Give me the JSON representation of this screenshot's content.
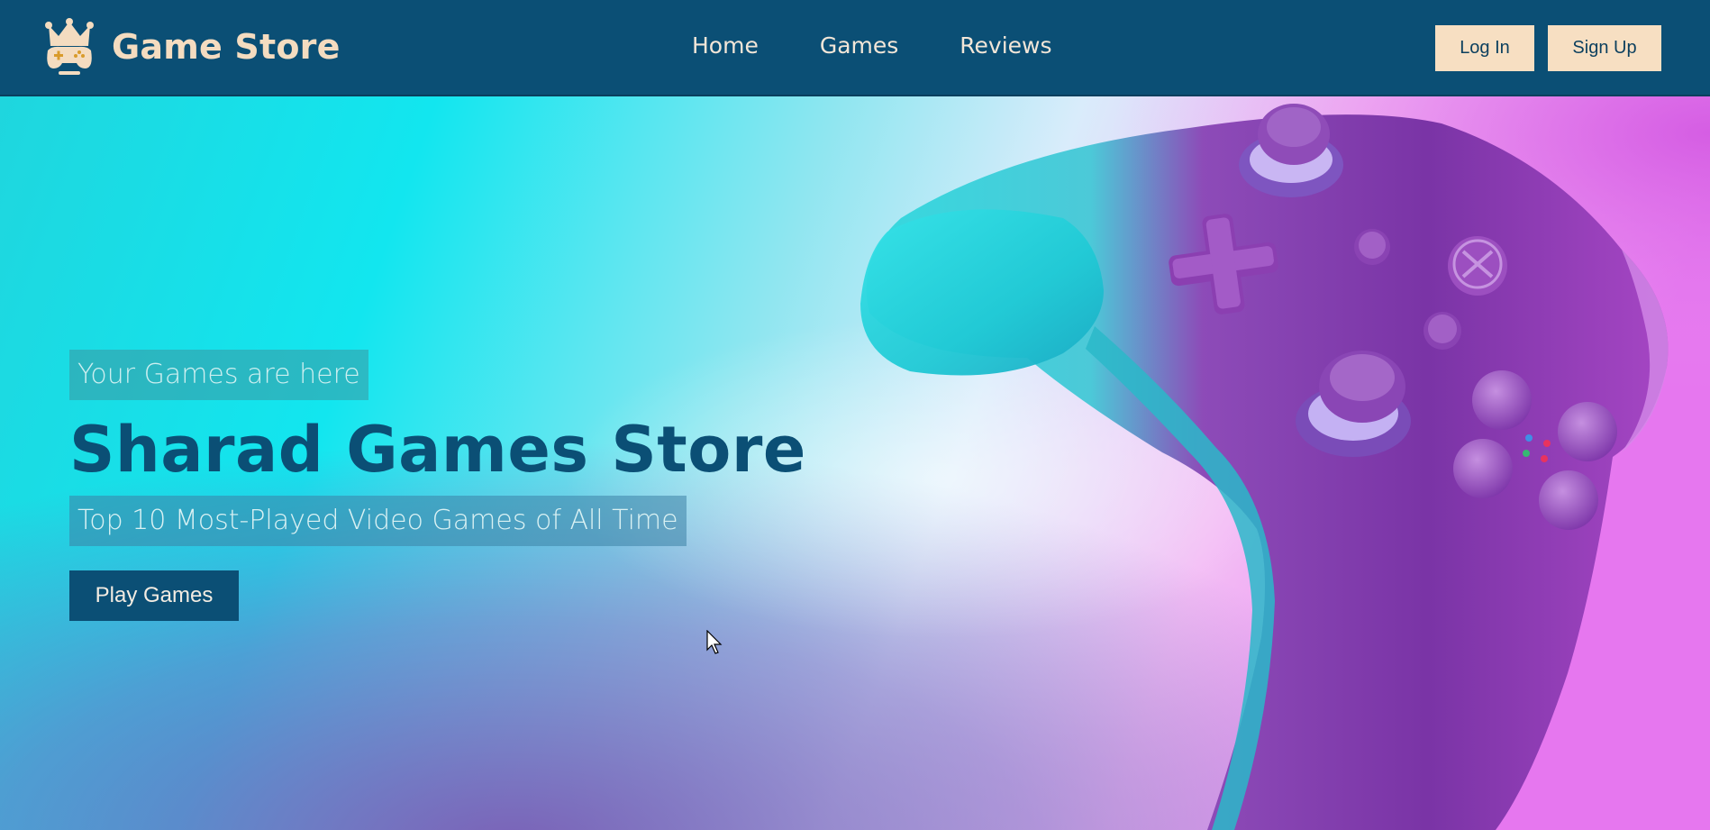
{
  "navbar": {
    "brand": "Game Store",
    "links": [
      "Home",
      "Games",
      "Reviews"
    ],
    "login_label": "Log In",
    "signup_label": "Sign Up"
  },
  "hero": {
    "tagline": "Your Games are here",
    "title": "Sharad Games Store",
    "subtitle": "Top 10 Most-Played Video Games of All Time",
    "cta_label": "Play Games"
  },
  "icons": {
    "logo": "crown-gamepad-icon",
    "cursor": "mouse-cursor-icon",
    "hero_image": "gamepad-controller-image"
  },
  "colors": {
    "navbar": "#0b4f75",
    "brand_text": "#f4dcc0",
    "auth_button": "#f7dfc2",
    "title": "#0b4f75",
    "cta_background": "#0b4f75",
    "cyan": "#12e3ee",
    "magenta": "#e06ce8"
  }
}
